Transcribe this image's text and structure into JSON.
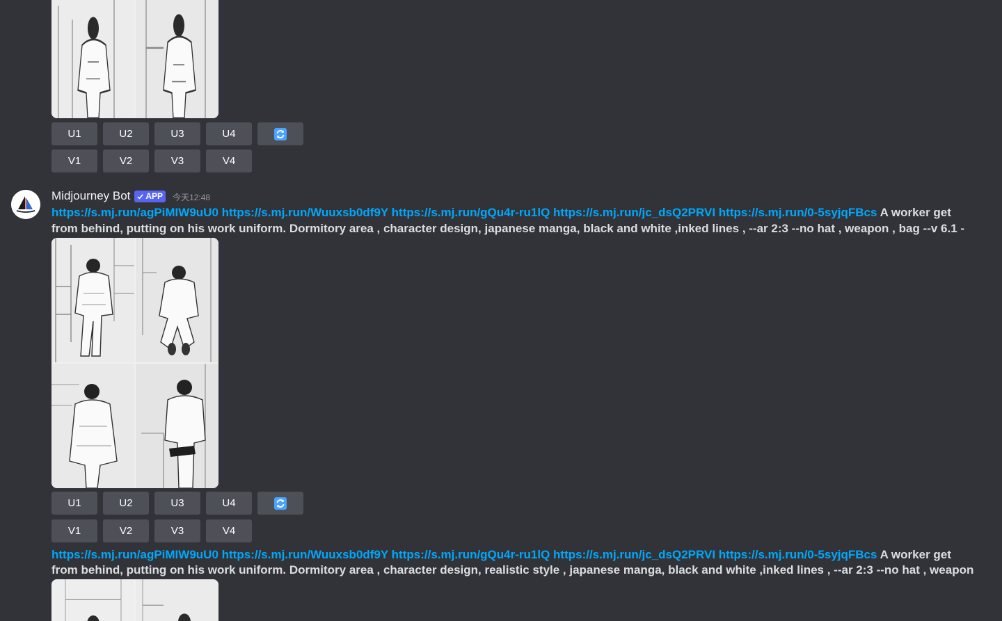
{
  "top_message": {
    "buttons_upscale": [
      "U1",
      "U2",
      "U3",
      "U4"
    ],
    "buttons_variation": [
      "V1",
      "V2",
      "V3",
      "V4"
    ],
    "reroll_icon": "refresh-icon"
  },
  "bot_message": {
    "username": "Midjourney Bot",
    "badge": "APP",
    "badge_icon": "checkmark-icon",
    "timestamp": "今天12:48",
    "links": [
      "https://s.mj.run/agPiMIW9uU0",
      "https://s.mj.run/Wuuxsb0df9Y",
      "https://s.mj.run/gQu4r-ru1lQ",
      "https://s.mj.run/jc_dsQ2PRVI",
      "https://s.mj.run/0-5syjqFBcs"
    ],
    "prompt_line1_suffix": "A worker get",
    "prompt_line2": "from behind, putting on his work uniform. Dormitory area , character design, japanese manga, black and white ,inked lines , --ar 2:3 --no hat , weapon , bag --v 6.1 -",
    "buttons_upscale": [
      "U1",
      "U2",
      "U3",
      "U4"
    ],
    "buttons_variation": [
      "V1",
      "V2",
      "V3",
      "V4"
    ],
    "reroll_icon": "refresh-icon"
  },
  "next_message": {
    "links": [
      "https://s.mj.run/agPiMIW9uU0",
      "https://s.mj.run/Wuuxsb0df9Y",
      "https://s.mj.run/gQu4r-ru1lQ",
      "https://s.mj.run/jc_dsQ2PRVI",
      "https://s.mj.run/0-5syjqFBcs"
    ],
    "prompt_line1_suffix": "A worker get",
    "prompt_line2": "from behind, putting on his work uniform. Dormitory area , character design, realistic style , japanese manga, black and white ,inked lines , --ar 2:3 --no hat , weapon"
  },
  "colors": {
    "background": "#313338",
    "button": "#4e5058",
    "link": "#00a8fc",
    "badge": "#5865f2",
    "reroll_icon": "#4aa3ff"
  }
}
